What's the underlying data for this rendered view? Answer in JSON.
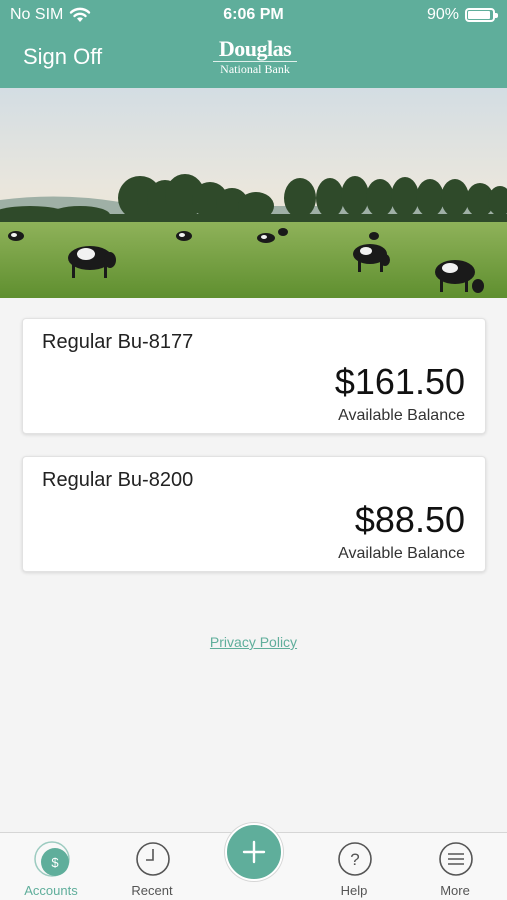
{
  "status_bar": {
    "carrier": "No SIM",
    "time": "6:06 PM",
    "battery_percent": "90%",
    "battery_level": 0.9
  },
  "nav": {
    "sign_off_label": "Sign Off",
    "logo_top": "Douglas",
    "logo_bottom": "National Bank"
  },
  "accounts": [
    {
      "name": "Regular Bu-8177",
      "amount": "$161.50",
      "balance_label": "Available Balance"
    },
    {
      "name": "Regular Bu-8200",
      "amount": "$88.50",
      "balance_label": "Available Balance"
    }
  ],
  "privacy_policy_label": "Privacy Policy",
  "tabs": [
    {
      "label": "Accounts",
      "icon": "dollar-icon",
      "active": true
    },
    {
      "label": "Recent",
      "icon": "clock-icon",
      "active": false
    },
    {
      "label": "Help",
      "icon": "question-icon",
      "active": false
    },
    {
      "label": "More",
      "icon": "menu-icon",
      "active": false
    }
  ],
  "fab_icon": "plus-icon",
  "colors": {
    "accent": "#5fae9b",
    "background": "#f4f4f4",
    "card": "#ffffff"
  }
}
